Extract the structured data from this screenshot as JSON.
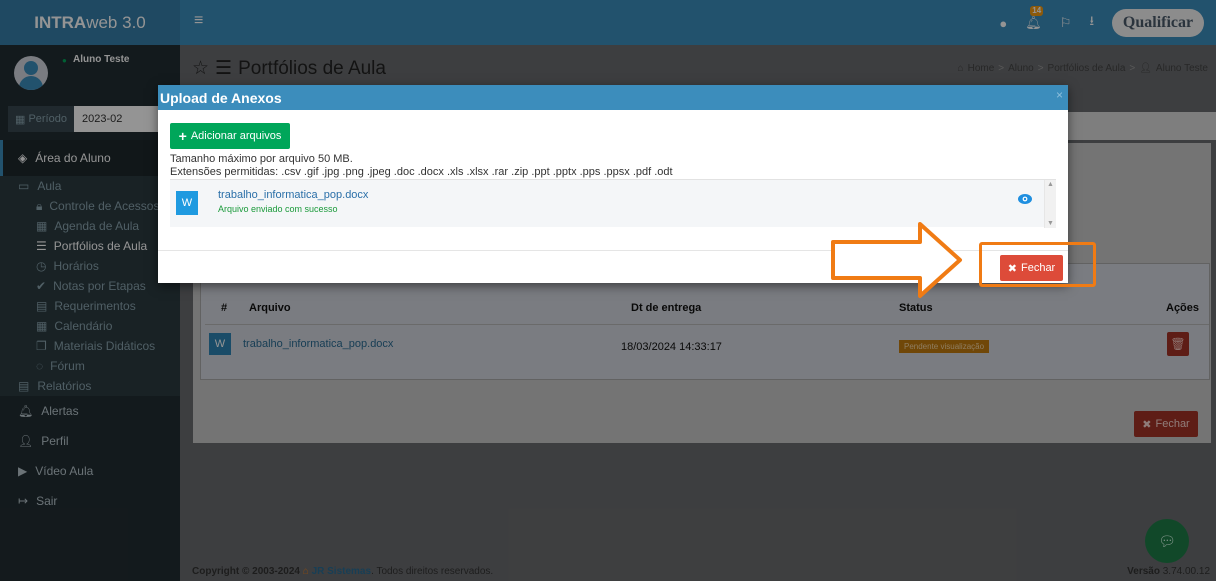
{
  "app": {
    "logo_bold": "INTRA",
    "logo_rest": "web 3.0",
    "notifications_count": "14",
    "brand_text": "ualificar"
  },
  "user": {
    "name": "Aluno Teste"
  },
  "period": {
    "label": "Período",
    "value": "2023-02"
  },
  "menu": {
    "area": "Área do Aluno",
    "aula": "Aula",
    "sub": [
      "Controle de Acessos",
      "Agenda de Aula",
      "Portfólios de Aula",
      "Horários",
      "Notas por Etapas",
      "Requerimentos",
      "Calendário",
      "Materiais Didáticos",
      "Fórum"
    ],
    "relatorios": "Relatórios",
    "alertas": "Alertas",
    "perfil": "Perfil",
    "video": "Vídeo Aula",
    "sair": "Sair"
  },
  "page": {
    "title": "Portfólios de Aula",
    "breadcrumb": [
      "Home",
      "Aluno",
      "Portfólios de Aula",
      "Aluno Teste"
    ]
  },
  "table": {
    "headers": [
      "#",
      "Arquivo",
      "Dt de entrega",
      "Status",
      "Ações"
    ],
    "rows": [
      {
        "file": "trabalho_informatica_pop.docx",
        "date": "18/03/2024 14:33:17",
        "status": "Pendente visualização"
      }
    ],
    "close_label": "Fechar"
  },
  "modal": {
    "title": "Upload de Anexos",
    "add_button": "Adicionar arquivos",
    "max_size": "Tamanho máximo por arquivo 50 MB.",
    "extensions": "Extensões permitidas: .csv .gif .jpg .png .jpeg .doc .docx .xls .xlsx .rar .zip .ppt .pptx .pps .ppsx .pdf .odt",
    "file_name": "trabalho_informatica_pop.docx",
    "file_status": "Arquivo enviado com sucesso",
    "close_button": "Fechar"
  },
  "footer": {
    "copyright_prefix": "Copyright © 2003-2024",
    "company": "JR Sistemas",
    "copyright_suffix": ". Todos direitos reservados.",
    "version_label": "Versão",
    "version": "3.74.00.12"
  },
  "colors": {
    "primary": "#3c8dbc",
    "success": "#00a65a",
    "danger": "#dd4b39",
    "annotation": "#f07b14"
  }
}
